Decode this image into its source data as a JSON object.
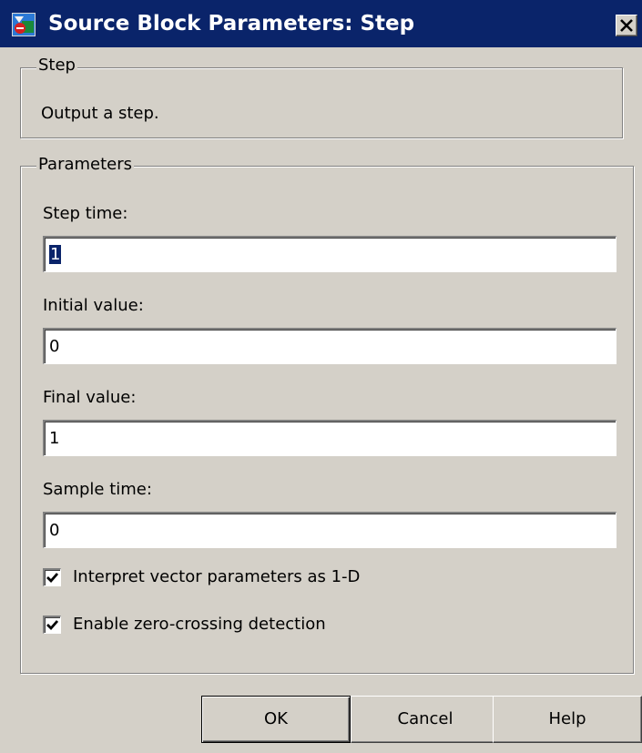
{
  "window": {
    "title": "Source Block Parameters: Step",
    "title_bar_color": "#0a246a",
    "icon": "simulink-block-icon",
    "close_icon": "close-icon"
  },
  "block_group": {
    "legend": "Step",
    "description": "Output a step."
  },
  "parameters_group": {
    "legend": "Parameters",
    "fields": [
      {
        "label": "Step time:",
        "value": "1",
        "selected": true
      },
      {
        "label": "Initial value:",
        "value": "0"
      },
      {
        "label": "Final value:",
        "value": "1"
      },
      {
        "label": "Sample time:",
        "value": "0"
      }
    ],
    "checkboxes": [
      {
        "label": "Interpret vector parameters as 1-D",
        "checked": true
      },
      {
        "label": "Enable zero-crossing detection",
        "checked": true
      }
    ]
  },
  "buttons": {
    "ok": "OK",
    "cancel": "Cancel",
    "help": "Help"
  }
}
